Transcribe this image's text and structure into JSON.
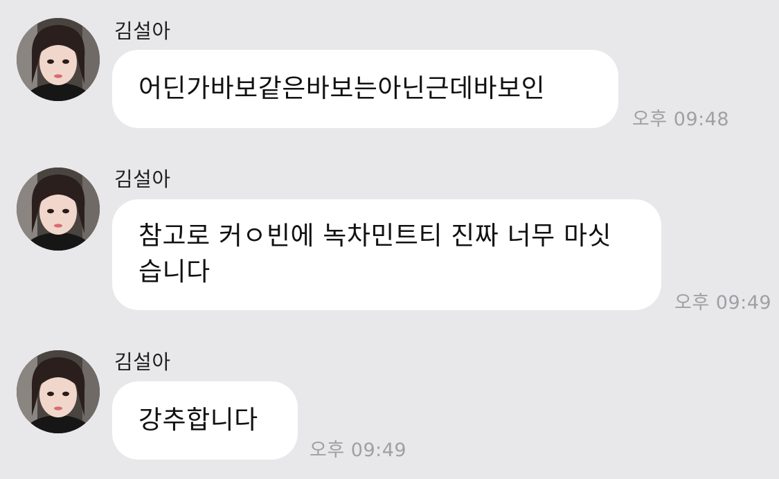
{
  "chat": {
    "messages": [
      {
        "sender": "김설아",
        "text": "어딘가바보같은바보는아닌근데바보인",
        "time": "오후 09:48"
      },
      {
        "sender": "김설아",
        "text": "참고로 커ㅇ빈에 녹차민트티 진짜 너무 마싯습니다",
        "time": "오후 09:49"
      },
      {
        "sender": "김설아",
        "text": "강추합니다",
        "time": "오후 09:49"
      }
    ]
  }
}
